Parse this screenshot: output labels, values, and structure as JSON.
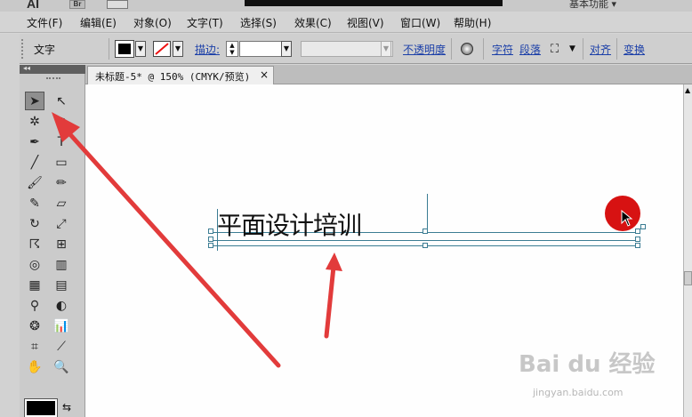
{
  "app": {
    "logo": "AI",
    "bridge": "Br",
    "workspace": "基本功能 ▾"
  },
  "menu": [
    {
      "label": "文件(F)"
    },
    {
      "label": "编辑(E)"
    },
    {
      "label": "对象(O)"
    },
    {
      "label": "文字(T)"
    },
    {
      "label": "选择(S)"
    },
    {
      "label": "效果(C)"
    },
    {
      "label": "视图(V)"
    },
    {
      "label": "窗口(W)"
    },
    {
      "label": "帮助(H)"
    }
  ],
  "control": {
    "tool_label": "文字",
    "stroke_label": "描边:",
    "opacity_label": "不透明度",
    "char_label": "字符",
    "para_label": "段落",
    "align_label": "对齐",
    "transform_label": "变换"
  },
  "document": {
    "tab_title": "未标题-5* @ 150% (CMYK/预览)",
    "close": "×"
  },
  "canvas": {
    "art_text": "平面设计培训"
  },
  "watermark": {
    "brand": "Bai du 经验",
    "url": "jingyan.baidu.com"
  },
  "colors": {
    "arrow": "#e23b3b",
    "dot": "#d71212",
    "guide": "#3b7c93",
    "link": "#1b3fa8"
  },
  "tools": [
    {
      "name": "selection-tool-icon",
      "glyph": "➤",
      "selected": true
    },
    {
      "name": "direct-selection-tool-icon",
      "glyph": "↖"
    },
    {
      "name": "magic-wand-tool-icon",
      "glyph": "✲"
    },
    {
      "name": "lasso-tool-icon",
      "glyph": "◌"
    },
    {
      "name": "pen-tool-icon",
      "glyph": "✒"
    },
    {
      "name": "type-tool-icon",
      "glyph": "T"
    },
    {
      "name": "line-tool-icon",
      "glyph": "╱"
    },
    {
      "name": "rectangle-tool-icon",
      "glyph": "▭"
    },
    {
      "name": "paintbrush-tool-icon",
      "glyph": "🖌"
    },
    {
      "name": "pencil-tool-icon",
      "glyph": "✏"
    },
    {
      "name": "blob-brush-tool-icon",
      "glyph": "✎"
    },
    {
      "name": "eraser-tool-icon",
      "glyph": "▱"
    },
    {
      "name": "rotate-tool-icon",
      "glyph": "↻"
    },
    {
      "name": "scale-tool-icon",
      "glyph": "⤢"
    },
    {
      "name": "warp-tool-icon",
      "glyph": "☈"
    },
    {
      "name": "free-transform-tool-icon",
      "glyph": "⊞"
    },
    {
      "name": "shape-builder-tool-icon",
      "glyph": "◎"
    },
    {
      "name": "perspective-grid-tool-icon",
      "glyph": "▥"
    },
    {
      "name": "mesh-tool-icon",
      "glyph": "▦"
    },
    {
      "name": "gradient-tool-icon",
      "glyph": "▤"
    },
    {
      "name": "eyedropper-tool-icon",
      "glyph": "⚲"
    },
    {
      "name": "blend-tool-icon",
      "glyph": "◐"
    },
    {
      "name": "symbol-sprayer-tool-icon",
      "glyph": "❂"
    },
    {
      "name": "graph-tool-icon",
      "glyph": "📊"
    },
    {
      "name": "artboard-tool-icon",
      "glyph": "⌗"
    },
    {
      "name": "slice-tool-icon",
      "glyph": "⟋"
    },
    {
      "name": "hand-tool-icon",
      "glyph": "✋"
    },
    {
      "name": "zoom-tool-icon",
      "glyph": "🔍"
    }
  ]
}
